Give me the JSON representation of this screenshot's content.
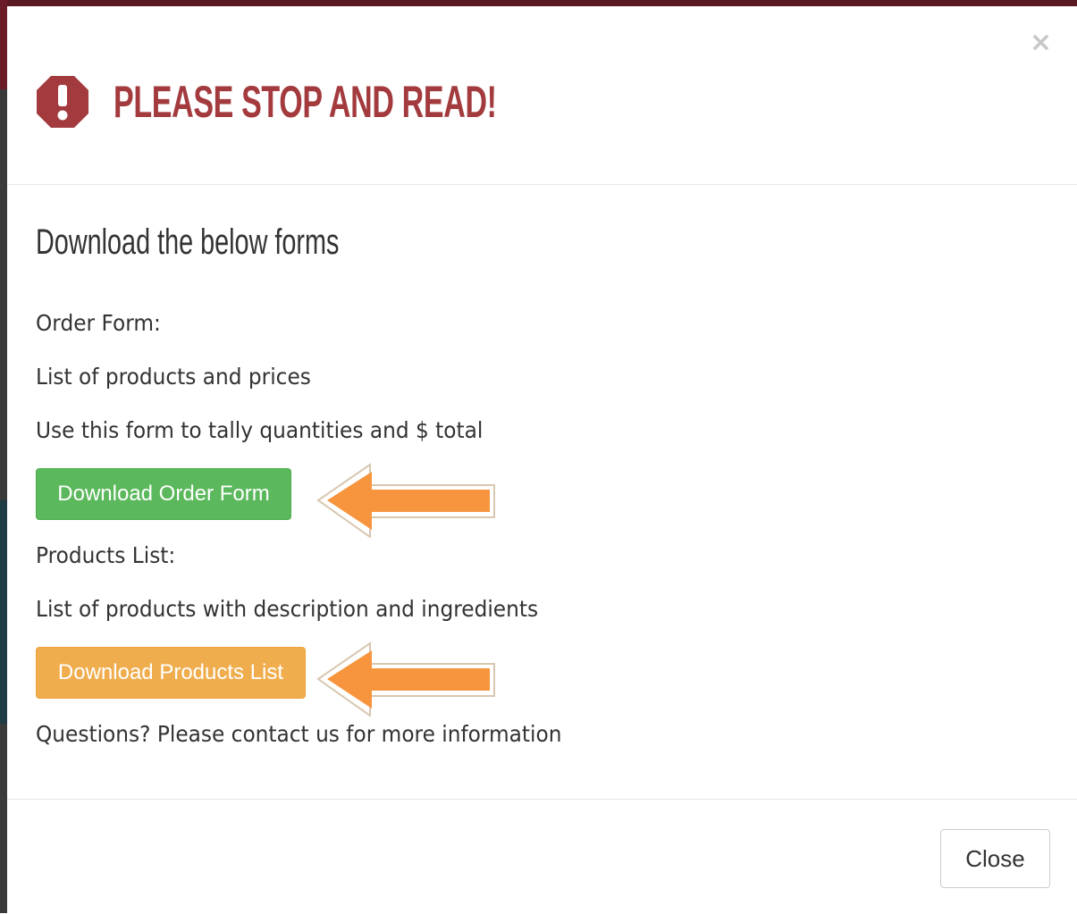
{
  "modal": {
    "title": "PLEASE STOP AND READ!",
    "close_icon_glyph": "×",
    "icon": "exclamation-octagon-icon",
    "title_color": "#a33a3e"
  },
  "body": {
    "heading": "Download the below forms",
    "order_label": "Order Form:",
    "order_desc1": "List of products and prices",
    "order_desc2": "Use this form to tally quantities and $ total",
    "order_button": "Download Order Form",
    "products_label": "Products List:",
    "products_desc": "List of products with description and ingredients",
    "products_button": "Download Products List",
    "questions": "Questions? Please contact us for more information"
  },
  "footer": {
    "close_button": "Close"
  },
  "colors": {
    "green_button": "#5cb85c",
    "orange_button": "#f0ad4e",
    "arrow": "#f7953f"
  }
}
